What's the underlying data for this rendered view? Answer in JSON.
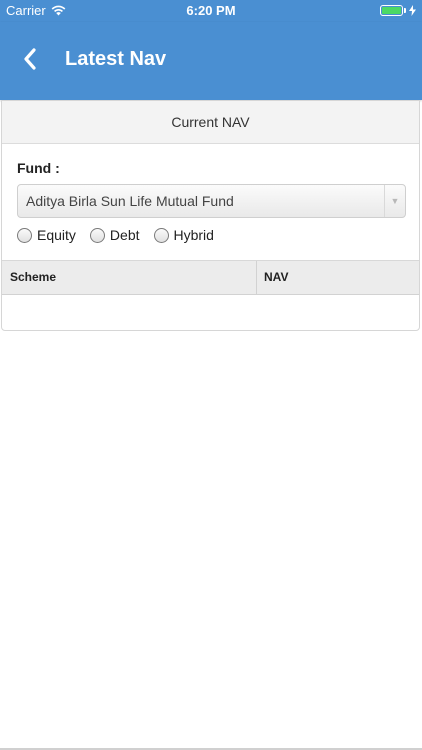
{
  "status_bar": {
    "carrier": "Carrier",
    "time": "6:20 PM"
  },
  "nav_bar": {
    "title": "Latest Nav"
  },
  "card": {
    "header": "Current NAV",
    "fund_label": "Fund :",
    "fund_select": {
      "value": "Aditya Birla Sun Life Mutual Fund"
    },
    "radios": [
      {
        "label": "Equity",
        "selected": false
      },
      {
        "label": "Debt",
        "selected": false
      },
      {
        "label": "Hybrid",
        "selected": false
      }
    ],
    "table": {
      "columns": [
        "Scheme",
        "NAV"
      ],
      "rows": []
    }
  },
  "colors": {
    "primary": "#4a8fd2",
    "battery": "#4cd964"
  }
}
